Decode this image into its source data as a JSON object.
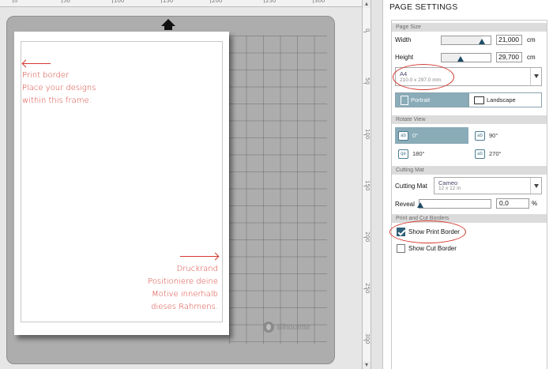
{
  "ruler": {
    "marks": [
      "0",
      "50",
      "100",
      "150",
      "200",
      "250",
      "300"
    ]
  },
  "vruler": {
    "marks": [
      "0",
      "50",
      "100",
      "150",
      "200",
      "250",
      "300"
    ]
  },
  "canvas": {
    "brand": "silhouette",
    "note_en": [
      "Print border",
      "Place your designs",
      "within this frame."
    ],
    "note_de": [
      "Druckrand",
      "Positioniere deine",
      "Motive innerhalb",
      "dieses Rahmens."
    ]
  },
  "panel": {
    "title": "PAGE SETTINGS",
    "page_size": {
      "section": "Page Size",
      "width_label": "Width",
      "width_value": "21,000",
      "width_unit": "cm",
      "width_fraction": 0.82,
      "height_label": "Height",
      "height_value": "29,700",
      "height_unit": "cm",
      "height_fraction": 0.38,
      "preset_name": "A4",
      "preset_dims": "210.0 x 297.0 mm",
      "portrait_label": "Portrait",
      "landscape_label": "Landscape"
    },
    "rotate": {
      "section": "Rotate View",
      "options": [
        "0°",
        "90°",
        "180°",
        "270°"
      ],
      "icons": [
        "ab",
        "ab",
        "qe",
        "ab"
      ]
    },
    "cutting_mat": {
      "section": "Cutting Mat",
      "label": "Cutting Mat",
      "mat_name": "Cameo",
      "mat_size": "12 x 12 in",
      "reveal_label": "Reveal",
      "reveal_value": "0,0",
      "reveal_unit": "%"
    },
    "borders": {
      "section": "Print and Cut Borders",
      "show_print_border": "Show Print Border",
      "show_print_border_checked": true,
      "show_cut_border": "Show Cut Border",
      "show_cut_border_checked": false
    }
  },
  "colors": {
    "accent": "#8aabb8",
    "annotation": "#d53a30",
    "mat": "#adadad"
  }
}
